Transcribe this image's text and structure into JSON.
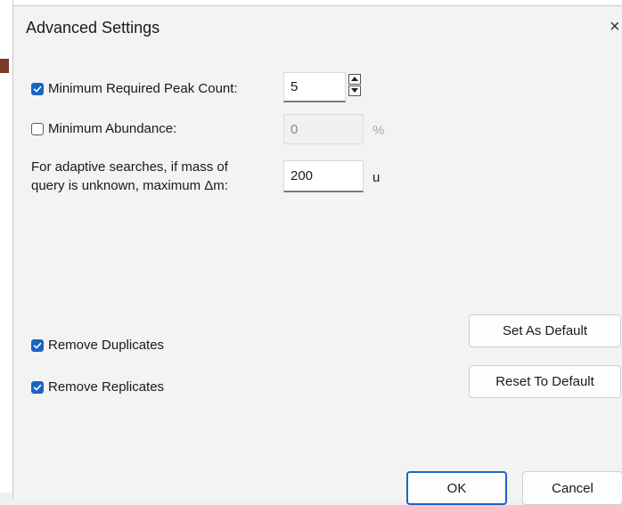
{
  "dialog": {
    "title": "Advanced Settings",
    "close_glyph": "×"
  },
  "settings": {
    "min_peak_count": {
      "label": "Minimum Required Peak Count:",
      "checked": true,
      "value": "5"
    },
    "min_abundance": {
      "label": "Minimum Abundance:",
      "checked": false,
      "value": "0",
      "unit": "%"
    },
    "adaptive": {
      "label_line1": "For adaptive searches, if mass of",
      "label_line2": "query is unknown, maximum Δm:",
      "value": "200",
      "unit": "u"
    },
    "remove_duplicates": {
      "label": "Remove Duplicates",
      "checked": true
    },
    "remove_replicates": {
      "label": "Remove Replicates",
      "checked": true
    }
  },
  "buttons": {
    "set_default": "Set As Default",
    "reset_default": "Reset To Default",
    "ok": "OK",
    "cancel": "Cancel"
  },
  "colors": {
    "accent": "#1a63c4",
    "background": "#f3f3f3"
  }
}
